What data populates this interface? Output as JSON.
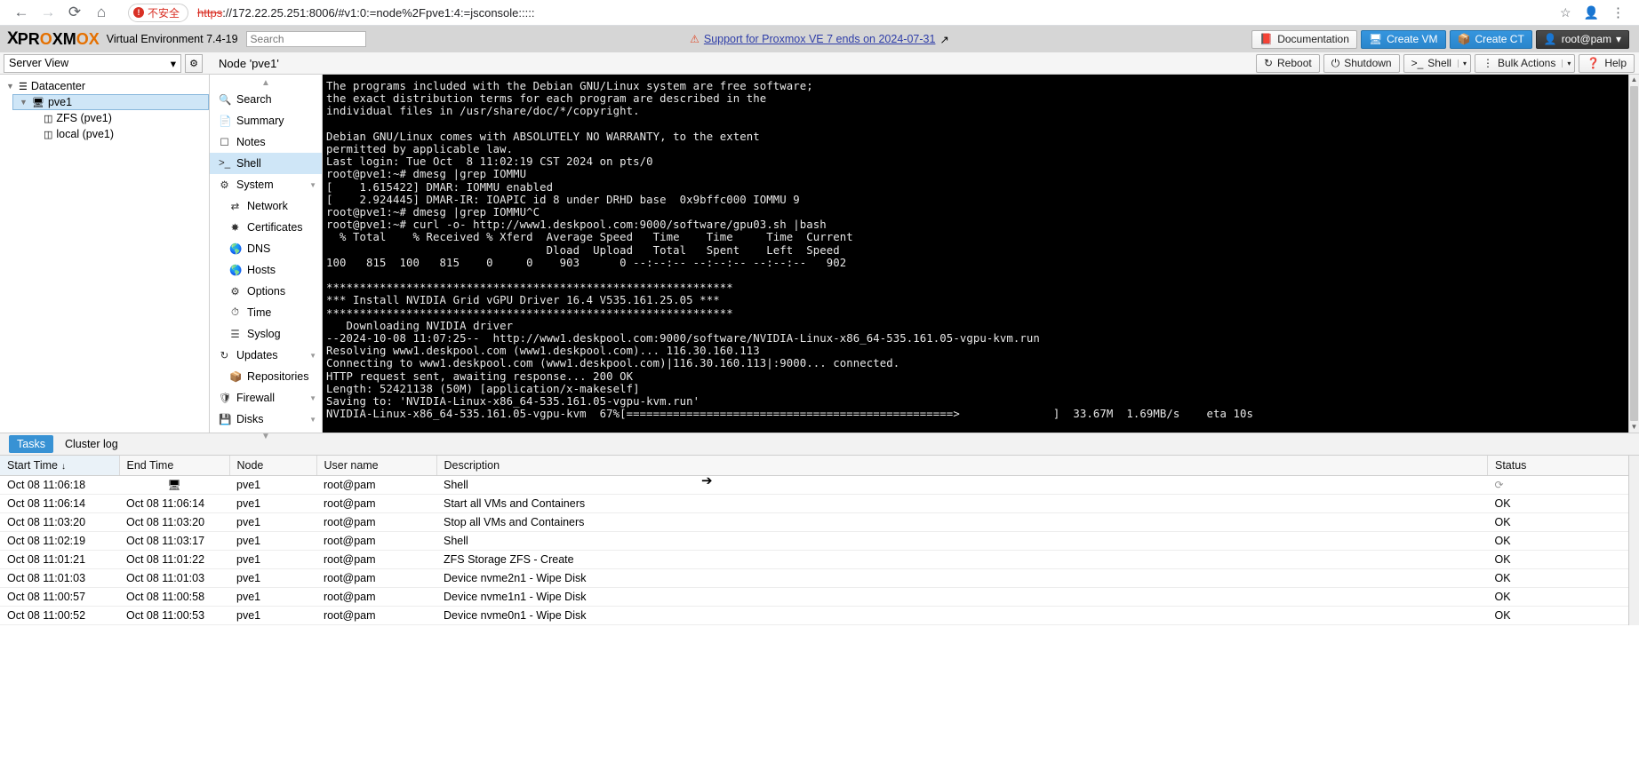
{
  "browser": {
    "back_icon": "back-arrow-icon",
    "forward_icon": "forward-arrow-icon",
    "reload_icon": "reload-icon",
    "home_icon": "home-icon",
    "security_label": "不安全",
    "url_scheme": "https",
    "url_rest": "://172.22.25.251:8006/#v1:0:=node%2Fpve1:4:=jsconsole:::::",
    "bookmark_icon": "star-icon",
    "profile_icon": "person-icon",
    "menu_icon": "kebab-menu-icon"
  },
  "header": {
    "logo_x": "X",
    "logo_text_1": "PR",
    "logo_text_o": "O",
    "logo_text_2": "XM",
    "logo_text_o2": "O",
    "logo_text_3": "X",
    "product": "Virtual Environment 7.4-19",
    "search_placeholder": "Search",
    "support_text": "Support for Proxmox VE 7 ends on 2024-07-31",
    "documentation": "Documentation",
    "create_vm": "Create VM",
    "create_ct": "Create CT",
    "user": "root@pam"
  },
  "toolbar": {
    "view_select": "Server View",
    "node_title": "Node 'pve1'",
    "reboot": "Reboot",
    "shutdown": "Shutdown",
    "shell": "Shell",
    "bulk_actions": "Bulk Actions",
    "help": "Help"
  },
  "tree": [
    {
      "label": "Datacenter",
      "icon": "datacenter-icon",
      "level": 0,
      "selected": false
    },
    {
      "label": "pve1",
      "icon": "node-icon",
      "level": 1,
      "selected": true
    },
    {
      "label": "ZFS (pve1)",
      "icon": "storage-icon",
      "level": 2,
      "selected": false
    },
    {
      "label": "local (pve1)",
      "icon": "storage-icon",
      "level": 2,
      "selected": false
    }
  ],
  "menu": [
    {
      "label": "Search",
      "icon": "search-icon",
      "sub": false,
      "selected": false,
      "arrow": false
    },
    {
      "label": "Summary",
      "icon": "summary-icon",
      "sub": false,
      "selected": false,
      "arrow": false
    },
    {
      "label": "Notes",
      "icon": "notes-icon",
      "sub": false,
      "selected": false,
      "arrow": false
    },
    {
      "label": "Shell",
      "icon": "shell-prompt-icon",
      "sub": false,
      "selected": true,
      "arrow": false
    },
    {
      "label": "System",
      "icon": "system-gears-icon",
      "sub": false,
      "selected": false,
      "arrow": true
    },
    {
      "label": "Network",
      "icon": "network-icon",
      "sub": true,
      "selected": false,
      "arrow": false
    },
    {
      "label": "Certificates",
      "icon": "certificate-icon",
      "sub": true,
      "selected": false,
      "arrow": false
    },
    {
      "label": "DNS",
      "icon": "globe-icon",
      "sub": true,
      "selected": false,
      "arrow": false
    },
    {
      "label": "Hosts",
      "icon": "globe-icon",
      "sub": true,
      "selected": false,
      "arrow": false
    },
    {
      "label": "Options",
      "icon": "gear-icon",
      "sub": true,
      "selected": false,
      "arrow": false
    },
    {
      "label": "Time",
      "icon": "clock-icon",
      "sub": true,
      "selected": false,
      "arrow": false
    },
    {
      "label": "Syslog",
      "icon": "syslog-icon",
      "sub": true,
      "selected": false,
      "arrow": false
    },
    {
      "label": "Updates",
      "icon": "updates-refresh-icon",
      "sub": false,
      "selected": false,
      "arrow": true
    },
    {
      "label": "Repositories",
      "icon": "repositories-icon",
      "sub": true,
      "selected": false,
      "arrow": false
    },
    {
      "label": "Firewall",
      "icon": "shield-icon",
      "sub": false,
      "selected": false,
      "arrow": true
    },
    {
      "label": "Disks",
      "icon": "disk-icon",
      "sub": false,
      "selected": false,
      "arrow": true
    }
  ],
  "terminal": {
    "text": "The programs included with the Debian GNU/Linux system are free software;\nthe exact distribution terms for each program are described in the\nindividual files in /usr/share/doc/*/copyright.\n\nDebian GNU/Linux comes with ABSOLUTELY NO WARRANTY, to the extent\npermitted by applicable law.\nLast login: Tue Oct  8 11:02:19 CST 2024 on pts/0\nroot@pve1:~# dmesg |grep IOMMU\n[    1.615422] DMAR: IOMMU enabled\n[    2.924445] DMAR-IR: IOAPIC id 8 under DRHD base  0x9bffc000 IOMMU 9\nroot@pve1:~# dmesg |grep IOMMU^C\nroot@pve1:~# curl -o- http://www1.deskpool.com:9000/software/gpu03.sh |bash\n  % Total    % Received % Xferd  Average Speed   Time    Time     Time  Current\n                                 Dload  Upload   Total   Spent    Left  Speed\n100   815  100   815    0     0    903      0 --:--:-- --:--:-- --:--:--   902\n\n*************************************************************\n*** Install NVIDIA Grid vGPU Driver 16.4 V535.161.25.05 ***\n*************************************************************\n   Downloading NVIDIA driver\n--2024-10-08 11:07:25--  http://www1.deskpool.com:9000/software/NVIDIA-Linux-x86_64-535.161.05-vgpu-kvm.run\nResolving www1.deskpool.com (www1.deskpool.com)... 116.30.160.113\nConnecting to www1.deskpool.com (www1.deskpool.com)|116.30.160.113|:9000... connected.\nHTTP request sent, awaiting response... 200 OK\nLength: 52421138 (50M) [application/x-makeself]\nSaving to: 'NVIDIA-Linux-x86_64-535.161.05-vgpu-kvm.run'\n",
    "progress_line": "NVIDIA-Linux-x86_64-535.161.05-vgpu-kvm  67%[=================================================>              ]  33.67M  1.69MB/s    eta 10s"
  },
  "tasks": {
    "tab_tasks": "Tasks",
    "tab_cluster": "Cluster log",
    "columns": [
      "Start Time",
      "End Time",
      "Node",
      "User name",
      "Description",
      "Status"
    ],
    "rows": [
      {
        "start": "Oct 08 11:06:18",
        "end": "",
        "end_icon": "monitor-icon",
        "node": "pve1",
        "user": "root@pam",
        "desc": "Shell",
        "status": "",
        "status_icon": "loading-spinner-icon"
      },
      {
        "start": "Oct 08 11:06:14",
        "end": "Oct 08 11:06:14",
        "node": "pve1",
        "user": "root@pam",
        "desc": "Start all VMs and Containers",
        "status": "OK"
      },
      {
        "start": "Oct 08 11:03:20",
        "end": "Oct 08 11:03:20",
        "node": "pve1",
        "user": "root@pam",
        "desc": "Stop all VMs and Containers",
        "status": "OK"
      },
      {
        "start": "Oct 08 11:02:19",
        "end": "Oct 08 11:03:17",
        "node": "pve1",
        "user": "root@pam",
        "desc": "Shell",
        "status": "OK"
      },
      {
        "start": "Oct 08 11:01:21",
        "end": "Oct 08 11:01:22",
        "node": "pve1",
        "user": "root@pam",
        "desc": "ZFS Storage ZFS - Create",
        "status": "OK"
      },
      {
        "start": "Oct 08 11:01:03",
        "end": "Oct 08 11:01:03",
        "node": "pve1",
        "user": "root@pam",
        "desc": "Device nvme2n1 - Wipe Disk",
        "status": "OK"
      },
      {
        "start": "Oct 08 11:00:57",
        "end": "Oct 08 11:00:58",
        "node": "pve1",
        "user": "root@pam",
        "desc": "Device nvme1n1 - Wipe Disk",
        "status": "OK"
      },
      {
        "start": "Oct 08 11:00:52",
        "end": "Oct 08 11:00:53",
        "node": "pve1",
        "user": "root@pam",
        "desc": "Device nvme0n1 - Wipe Disk",
        "status": "OK"
      }
    ]
  }
}
